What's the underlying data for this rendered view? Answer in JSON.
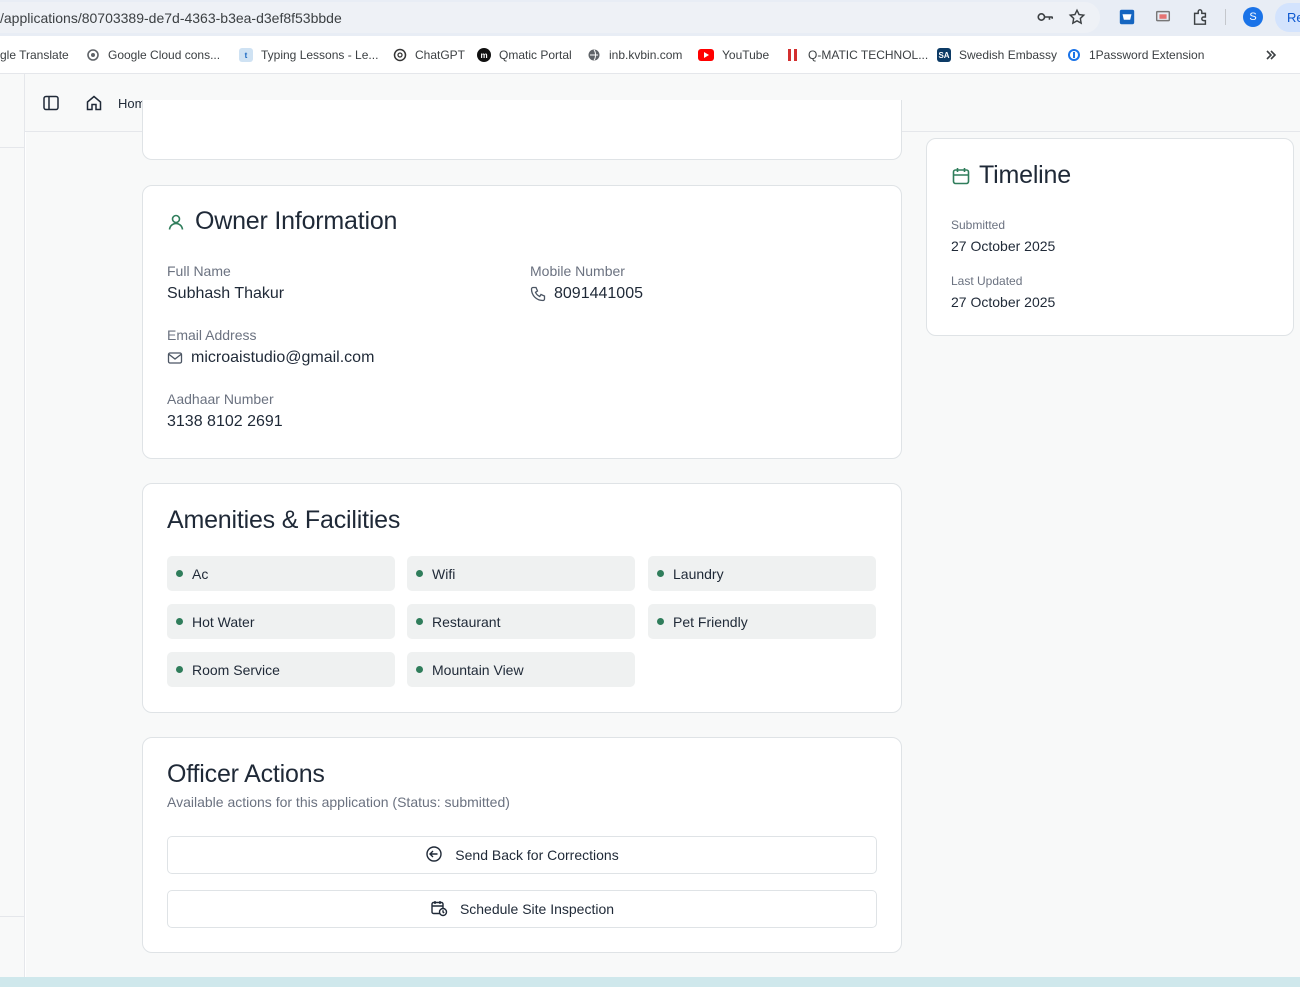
{
  "browser": {
    "url": "/applications/80703389-de7d-4363-b3ea-d3ef8f53bbde",
    "relaunch_label": "Re",
    "profile_initial": "S",
    "bookmarks": [
      {
        "label": "gle Translate",
        "icon": "translate-icon"
      },
      {
        "label": "Google Cloud cons...",
        "icon": "cloud-icon"
      },
      {
        "label": "Typing Lessons - Le...",
        "icon": "typing-icon"
      },
      {
        "label": "ChatGPT",
        "icon": "chatgpt-icon"
      },
      {
        "label": "Qmatic Portal",
        "icon": "qmatic-icon"
      },
      {
        "label": "inb.kvbin.com",
        "icon": "globe-icon"
      },
      {
        "label": "YouTube",
        "icon": "youtube-icon"
      },
      {
        "label": "Q-MATIC TECHNOL...",
        "icon": "qmatic-tech-icon"
      },
      {
        "label": "Swedish Embassy",
        "icon": "sa-icon"
      },
      {
        "label": "1Password Extension",
        "icon": "1password-icon"
      }
    ]
  },
  "header": {
    "home_label": "Home"
  },
  "owner": {
    "title": "Owner Information",
    "full_name_label": "Full Name",
    "full_name": "Subhash Thakur",
    "mobile_label": "Mobile Number",
    "mobile": "8091441005",
    "email_label": "Email Address",
    "email": "microaistudio@gmail.com",
    "aadhaar_label": "Aadhaar Number",
    "aadhaar": "3138 8102 2691"
  },
  "amenities": {
    "title": "Amenities & Facilities",
    "items": [
      "Ac",
      "Wifi",
      "Laundry",
      "Hot Water",
      "Restaurant",
      "Pet Friendly",
      "Room Service",
      "Mountain View"
    ]
  },
  "officer": {
    "title": "Officer Actions",
    "subtitle": "Available actions for this application (Status: submitted)",
    "send_back_label": "Send Back for Corrections",
    "schedule_label": "Schedule Site Inspection"
  },
  "timeline": {
    "title": "Timeline",
    "submitted_label": "Submitted",
    "submitted_value": "27 October 2025",
    "updated_label": "Last Updated",
    "updated_value": "27 October 2025"
  },
  "colors": {
    "accent_green": "#2f7d5b",
    "card_border": "#dfe3e6",
    "page_bg": "#f8f9f9"
  }
}
